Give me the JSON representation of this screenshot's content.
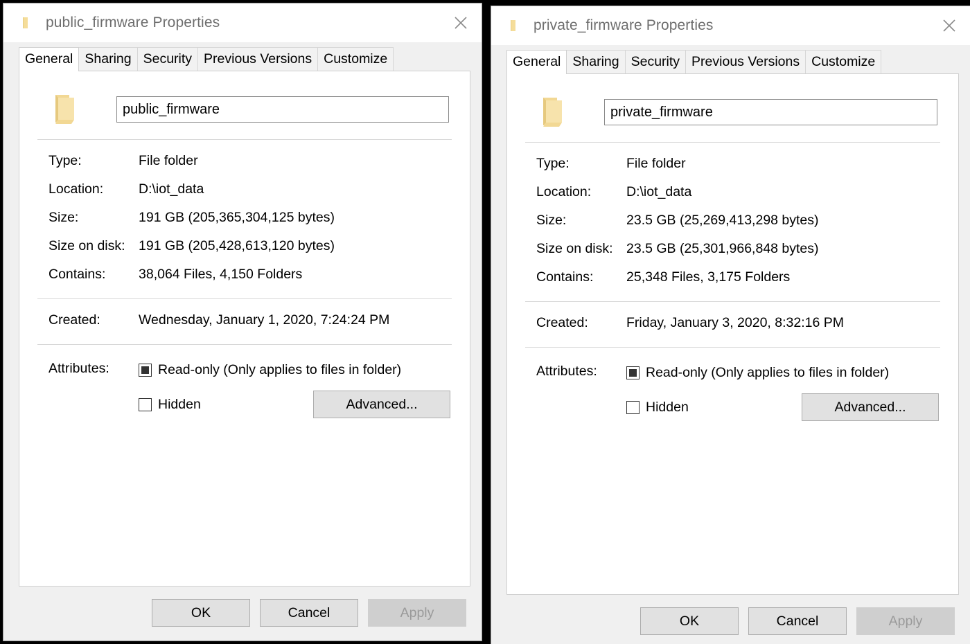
{
  "dialogs": [
    {
      "title": "public_firmware Properties",
      "title_icon": "folder-icon",
      "close_icon": "close-icon",
      "tabs": [
        {
          "label": "General",
          "active": true
        },
        {
          "label": "Sharing",
          "active": false
        },
        {
          "label": "Security",
          "active": false
        },
        {
          "label": "Previous Versions",
          "active": false
        },
        {
          "label": "Customize",
          "active": false
        }
      ],
      "folder_icon": "folder-icon",
      "name_value": "public_firmware",
      "info": [
        {
          "label": "Type:",
          "value": "File folder"
        },
        {
          "label": "Location:",
          "value": "D:\\iot_data"
        },
        {
          "label": "Size:",
          "value": "191 GB (205,365,304,125 bytes)"
        },
        {
          "label": "Size on disk:",
          "value": "191 GB (205,428,613,120 bytes)"
        },
        {
          "label": "Contains:",
          "value": "38,064 Files, 4,150 Folders"
        }
      ],
      "created": {
        "label": "Created:",
        "value": "Wednesday, January 1, 2020, 7:24:24 PM"
      },
      "attributes": {
        "label": "Attributes:",
        "readonly_label": "Read-only (Only applies to files in folder)",
        "readonly_state": "mixed",
        "hidden_label": "Hidden",
        "hidden_state": "unchecked",
        "advanced_label": "Advanced..."
      },
      "footer": {
        "ok_label": "OK",
        "cancel_label": "Cancel",
        "apply_label": "Apply",
        "apply_disabled": true
      }
    },
    {
      "title": "private_firmware Properties",
      "title_icon": "folder-icon",
      "close_icon": "close-icon",
      "tabs": [
        {
          "label": "General",
          "active": true
        },
        {
          "label": "Sharing",
          "active": false
        },
        {
          "label": "Security",
          "active": false
        },
        {
          "label": "Previous Versions",
          "active": false
        },
        {
          "label": "Customize",
          "active": false
        }
      ],
      "folder_icon": "folder-icon",
      "name_value": "private_firmware",
      "info": [
        {
          "label": "Type:",
          "value": "File folder"
        },
        {
          "label": "Location:",
          "value": "D:\\iot_data"
        },
        {
          "label": "Size:",
          "value": "23.5 GB (25,269,413,298 bytes)"
        },
        {
          "label": "Size on disk:",
          "value": "23.5 GB (25,301,966,848 bytes)"
        },
        {
          "label": "Contains:",
          "value": "25,348 Files, 3,175 Folders"
        }
      ],
      "created": {
        "label": "Created:",
        "value": "Friday, January 3, 2020, 8:32:16 PM"
      },
      "attributes": {
        "label": "Attributes:",
        "readonly_label": "Read-only (Only applies to files in folder)",
        "readonly_state": "mixed",
        "hidden_label": "Hidden",
        "hidden_state": "unchecked",
        "advanced_label": "Advanced..."
      },
      "footer": {
        "ok_label": "OK",
        "cancel_label": "Cancel",
        "apply_label": "Apply",
        "apply_disabled": true
      }
    }
  ],
  "colors": {
    "folder_fill": "#f5dd9a",
    "folder_fill_dark": "#e8cf84",
    "title_text": "#6e6e6e",
    "dialog_bg": "#f0f0f0",
    "panel_bg": "#ffffff",
    "button_bg": "#e1e1e1",
    "button_disabled_bg": "#cfcfcf"
  }
}
